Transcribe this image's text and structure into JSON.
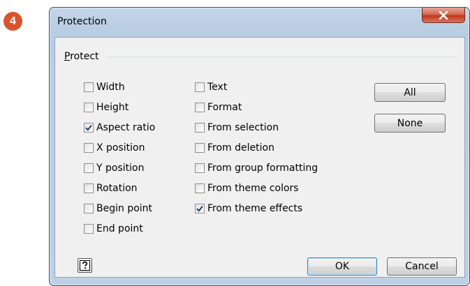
{
  "step_badge": "4",
  "window": {
    "title": "Protection",
    "close_icon": "close-x-icon"
  },
  "group": {
    "label_access_key": "P",
    "label_rest": "rotect"
  },
  "left_options": [
    {
      "label": "Width",
      "checked": false
    },
    {
      "label": "Height",
      "checked": false
    },
    {
      "label": "Aspect ratio",
      "checked": true
    },
    {
      "label": "X position",
      "checked": false
    },
    {
      "label": "Y position",
      "checked": false
    },
    {
      "label": "Rotation",
      "checked": false
    },
    {
      "label": "Begin point",
      "checked": false
    },
    {
      "label": "End point",
      "checked": false
    }
  ],
  "right_options": [
    {
      "label": "Text",
      "checked": false
    },
    {
      "label": "Format",
      "checked": false
    },
    {
      "label": "From selection",
      "checked": false
    },
    {
      "label": "From deletion",
      "checked": false
    },
    {
      "label": "From group formatting",
      "checked": false
    },
    {
      "label": "From theme colors",
      "checked": false
    },
    {
      "label": "From theme effects",
      "checked": true
    }
  ],
  "buttons": {
    "all": "All",
    "none": "None",
    "ok": "OK",
    "cancel": "Cancel",
    "help_icon": "help-question-icon"
  },
  "colors": {
    "badge": "#d9532b",
    "close": "#c0391f",
    "default_button_border": "#3c7fb1"
  }
}
